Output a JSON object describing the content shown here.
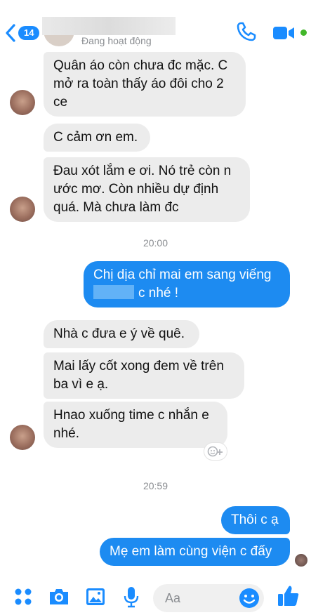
{
  "header": {
    "back_badge": "14",
    "status": "Đang hoạt động"
  },
  "messages": {
    "m1": "Quân áo còn chưa đc mặc. C mở ra toàn thấy áo đôi cho 2 ce",
    "m2": "C cảm ơn em.",
    "m3": "Đau xót lắm e ơi. Nó trẻ còn n ước mơ. Còn nhiều dự định quá. Mà chưa làm đc",
    "time1": "20:00",
    "m4a": "Chị dịa chỉ mai em sang viếng",
    "m4b": "c nhé !",
    "m5": "Nhà c đưa e ý về quê.",
    "m6": "Mai lấy cốt xong đem về trên ba vì e ạ.",
    "m7": "Hnao xuống time c nhắn e nhé.",
    "time2": "20:59",
    "m8": "Thôi c ạ",
    "m9": "Mẹ em làm cùng viện c đấy"
  },
  "composer": {
    "placeholder": "Aa"
  },
  "colors": {
    "accent": "#1d8bf1",
    "incoming_bubble": "#ececec",
    "online": "#42b72a"
  },
  "icons": [
    "back-chevron-icon",
    "phone-icon",
    "video-camera-icon",
    "menu-dots-icon",
    "camera-icon",
    "photo-icon",
    "microphone-icon",
    "emoji-icon",
    "thumbs-up-icon",
    "add-reaction-icon"
  ]
}
